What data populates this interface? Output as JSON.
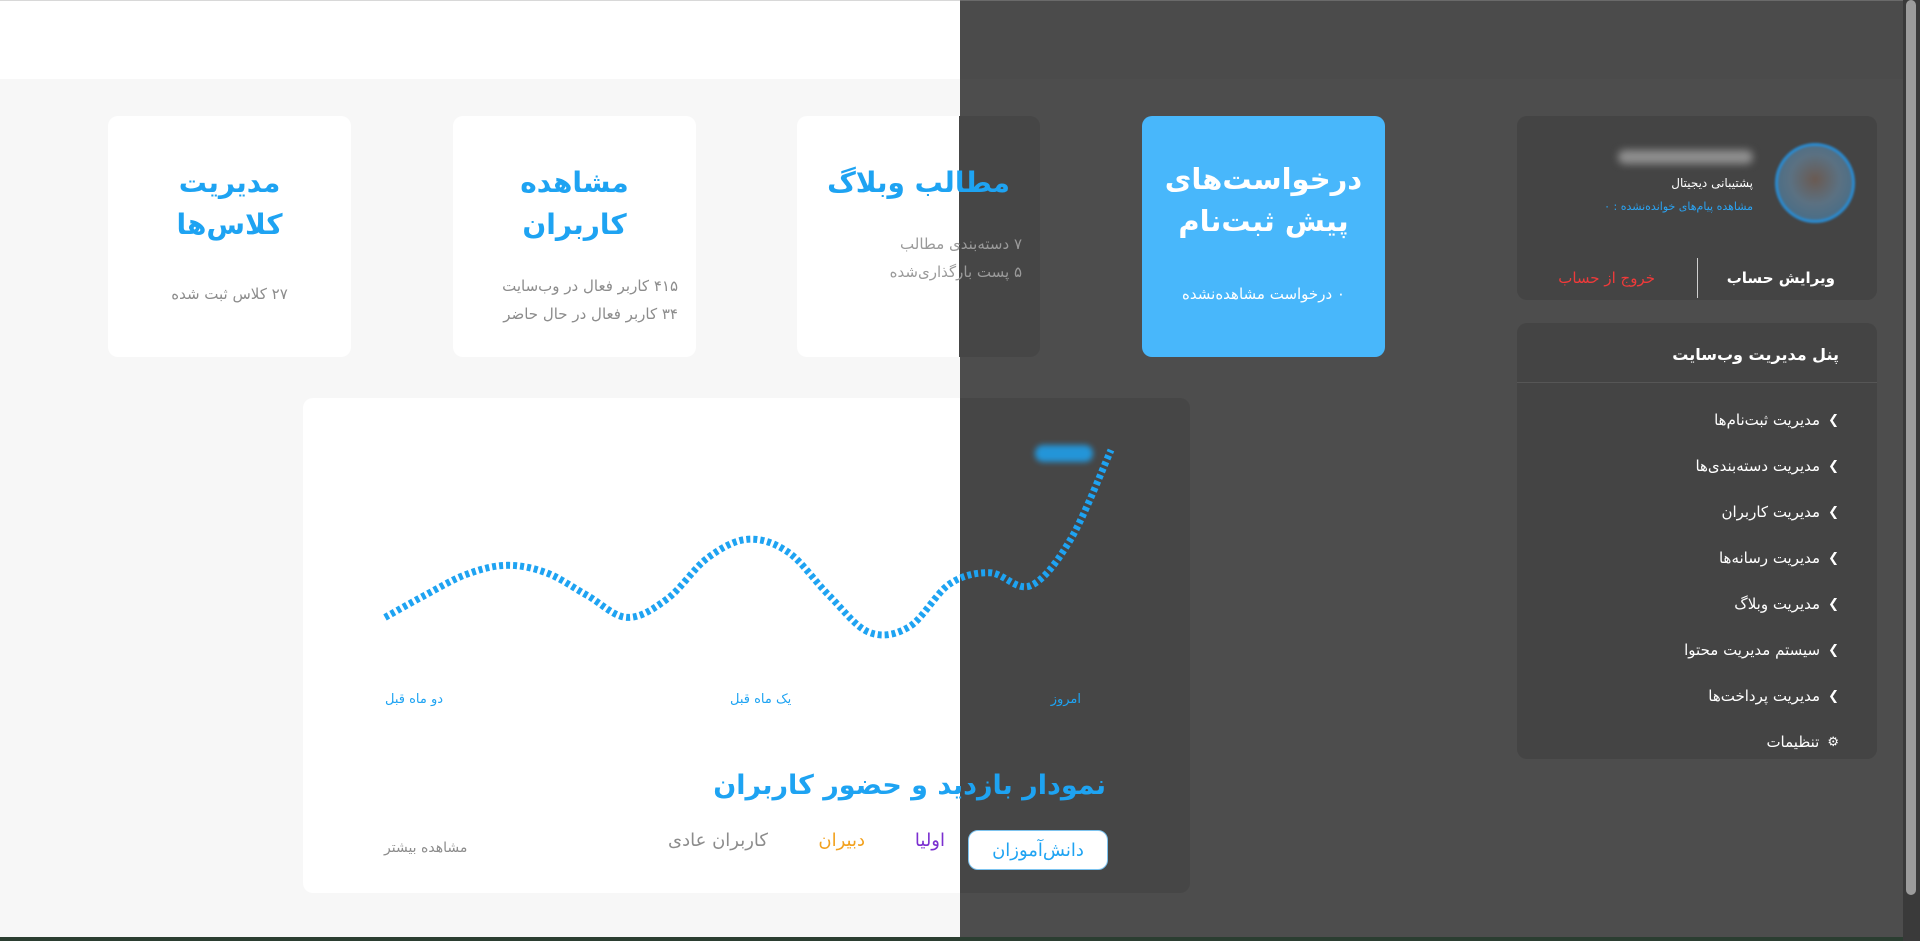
{
  "colors": {
    "accent": "#1ea3f2",
    "highlight_card": "#48b7fb",
    "logout": "#f03a3a",
    "tab_parents": "#7b2fd0",
    "tab_teachers": "#f2a11e",
    "tab_regular": "#8c8c8c"
  },
  "cards": [
    {
      "title": "درخواست‌های پیش ثبت‌نام",
      "lines": [
        "۰ درخواست مشاهده‌نشده"
      ]
    },
    {
      "title": "مطالب وبلاگ",
      "lines": [
        "۷ دسته‌بندی مطالب",
        "۵ پست بارگذاری‌شده"
      ]
    },
    {
      "title": "مشاهده کاربران",
      "lines": [
        "۴۱۵ کاربر فعال در وب‌سایت",
        "۳۴ کاربر فعال در حال حاضر"
      ]
    },
    {
      "title": "مدیریت کلاس‌ها",
      "lines": [
        "۲۷ کلاس ثبت شده"
      ]
    }
  ],
  "profile": {
    "role": "پشتیبانی دیجیتال",
    "unread": "مشاهده پیام‌های خوانده‌نشده : ۰",
    "edit": "ویرایش حساب",
    "logout": "خروج از حساب"
  },
  "menu": {
    "title": "پنل مدیریت وب‌سایت",
    "items": [
      {
        "label": "مدیریت ثبت‌نام‌ها",
        "icon": "chevron-right-icon"
      },
      {
        "label": "مدیریت دسته‌بندی‌ها",
        "icon": "chevron-right-icon"
      },
      {
        "label": "مدیریت کاربران",
        "icon": "chevron-right-icon"
      },
      {
        "label": "مدیریت رسانه‌ها",
        "icon": "chevron-right-icon"
      },
      {
        "label": "مدیریت وبلاگ",
        "icon": "chevron-right-icon"
      },
      {
        "label": "سیستم مدیریت محتوا",
        "icon": "chevron-right-icon"
      },
      {
        "label": "مدیریت پرداخت‌ها",
        "icon": "chevron-right-icon"
      },
      {
        "label": "تنظیمات",
        "icon": "gear-icon"
      }
    ]
  },
  "chart": {
    "title": "نمودار بازدید و حضور کاربران",
    "tabs": [
      "دانش‌آموزان",
      "اولیا",
      "دبیران",
      "کاربران عادی"
    ],
    "active_tab": "دانش‌آموزان",
    "see_more": "مشاهده بیشتر"
  },
  "chart_data": {
    "type": "line",
    "title": "نمودار بازدید و حضور کاربران",
    "x_tick_labels": [
      "دو ماه قبل",
      "یک ماه قبل",
      "امروز"
    ],
    "yaxis": "hidden",
    "grid": false,
    "series": [
      {
        "values": [
          0.1,
          0.22,
          0.33,
          0.38,
          0.34,
          0.22,
          0.1,
          0.2,
          0.42,
          0.52,
          0.45,
          0.22,
          0.02,
          0.05,
          0.28,
          0.34,
          0.27,
          0.52,
          1.0
        ]
      }
    ]
  }
}
